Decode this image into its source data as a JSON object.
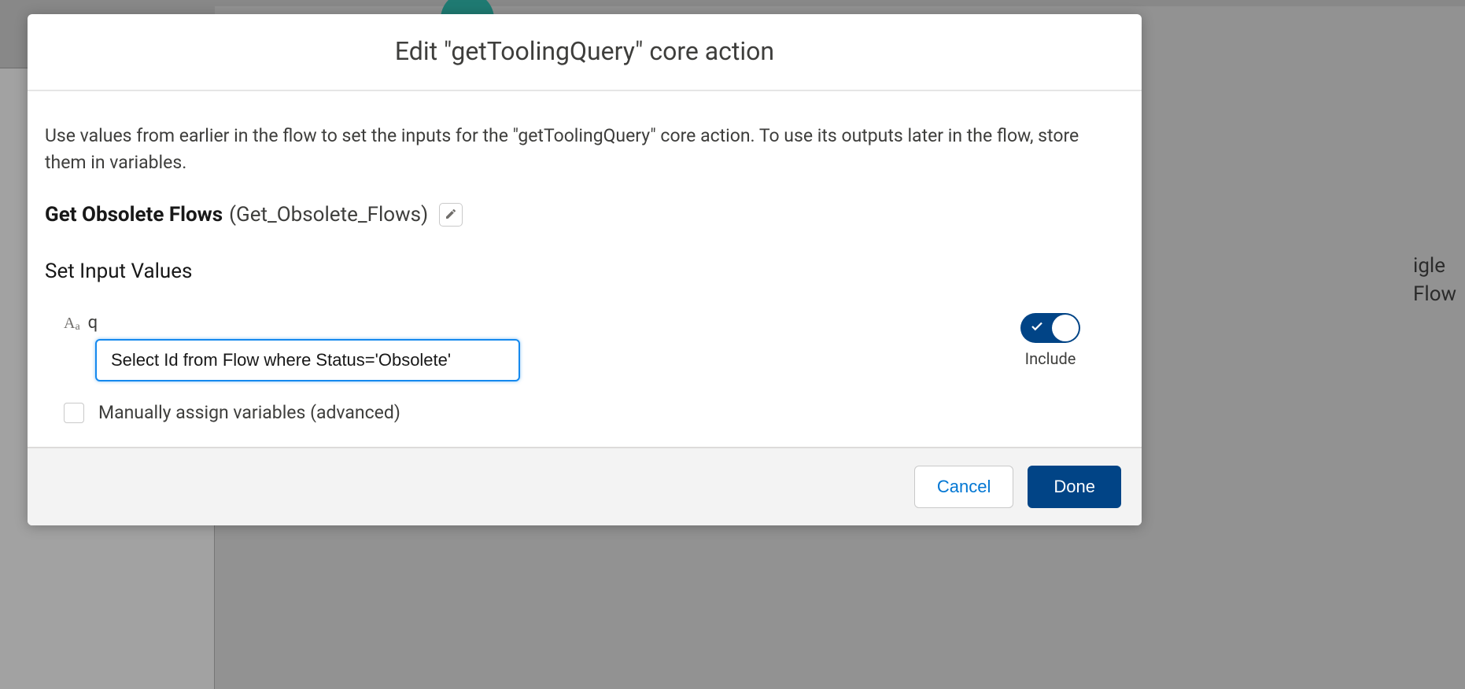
{
  "modal": {
    "title": "Edit \"getToolingQuery\" core action",
    "description": "Use values from earlier in the flow to set the inputs for the \"getToolingQuery\" core action. To use its outputs later in the flow, store them in variables.",
    "element_label": "Get Obsolete Flows",
    "element_api": "(Get_Obsolete_Flows)",
    "section_heading": "Set Input Values",
    "input": {
      "label": "q",
      "value": "Select Id from Flow where Status='Obsolete'"
    },
    "toggle": {
      "label": "Include",
      "on": true
    },
    "checkbox": {
      "label": "Manually assign variables (advanced)",
      "checked": false
    },
    "footer": {
      "cancel": "Cancel",
      "done": "Done"
    }
  },
  "background": {
    "right_text": "igle\nFlow"
  }
}
